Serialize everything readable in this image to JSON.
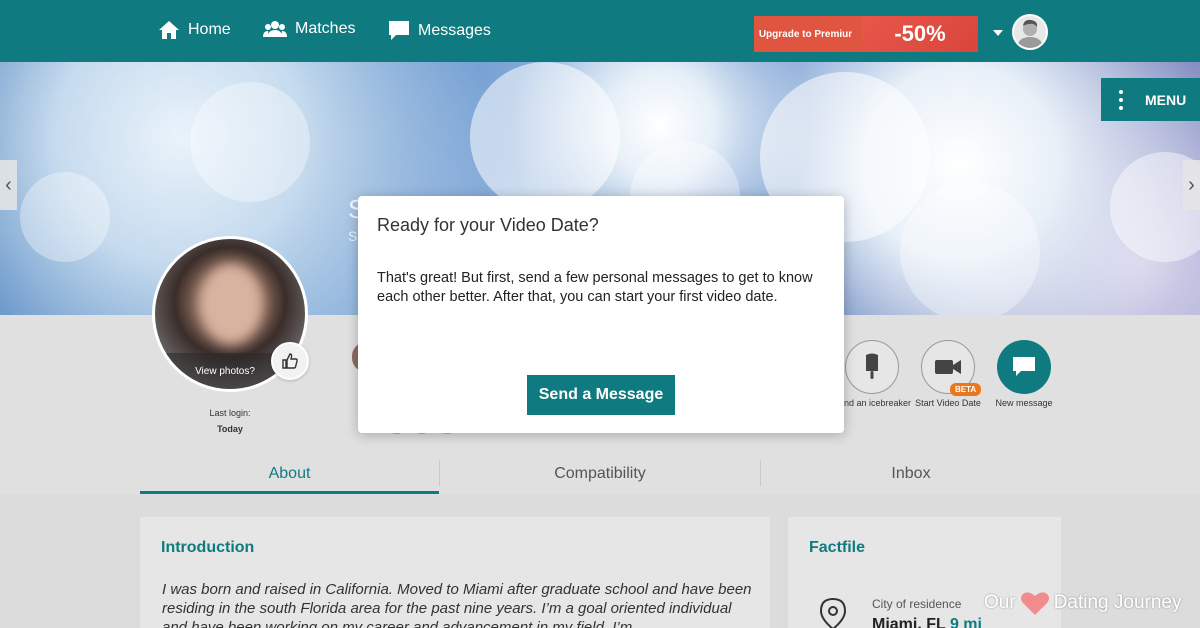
{
  "nav": {
    "home_label": "Home",
    "matches_label": "Matches",
    "messages_label": "Messages",
    "upgrade_label": "Upgrade to Premium",
    "discount_label": "-50%"
  },
  "hero": {
    "menu_label": "MENU",
    "name_partial": "S",
    "sub_partial": "S"
  },
  "profile": {
    "view_photos_label": "View photos?",
    "last_login_label": "Last login:",
    "last_login_value": "Today",
    "number_partial": "- - -"
  },
  "actions": [
    {
      "label": "Send an icebreaker",
      "icon": "popsicle-icon"
    },
    {
      "label": "Start Video Date",
      "icon": "video-camera-icon",
      "badge": "BETA"
    },
    {
      "label": "New message",
      "icon": "chat-bubble-icon"
    }
  ],
  "tabs": [
    {
      "label": "About",
      "active": true
    },
    {
      "label": "Compatibility",
      "active": false
    },
    {
      "label": "Inbox",
      "active": false
    }
  ],
  "introduction": {
    "heading": "Introduction",
    "text": "I was born and raised in California. Moved to Miami after graduate school and have been residing in the south Florida area for the past nine years. I’m a goal oriented individual and have been working on my career and advancement in my field. I’m"
  },
  "factfile": {
    "heading": "Factfile",
    "city_label": "City of residence",
    "city_value": "Miami, FL",
    "distance_value": "9 mi"
  },
  "modal": {
    "title": "Ready for your Video Date?",
    "body": "That's great! But first, send a few personal messages to get to know each other better. After that, you can start your first video date.",
    "button_label": "Send a Message"
  },
  "watermark": {
    "text_left": "Our",
    "text_right": "Dating Journey"
  },
  "colors": {
    "brand_teal": "#0f7b80",
    "promo_red": "#e0553f",
    "beta_orange": "#e8781e"
  }
}
